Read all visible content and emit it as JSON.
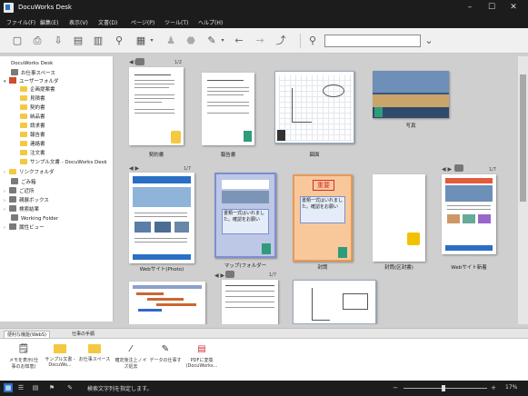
{
  "window": {
    "title": "DocuWorks Desk"
  },
  "menu": [
    "ファイル(F)",
    "編集(E)",
    "表示(V)",
    "文書(D)",
    "ページ(P)",
    "ツール(T)",
    "ヘルプ(H)"
  ],
  "tree": {
    "root": "DocuWorks Desk",
    "items": [
      "お仕事スペース",
      "ユーザーフォルダ",
      "企画提案書",
      "見積書",
      "契約書",
      "納品書",
      "請求書",
      "報告書",
      "連絡書",
      "注文書",
      "サンプル文書 - DocuWorks Desk",
      "リンクフォルダ",
      "ごみ箱",
      "ご近所",
      "親展ボックス",
      "検索結果",
      "Working Folder",
      "属性ビュー"
    ]
  },
  "documents": [
    {
      "caption": "契約書",
      "pages": "1/2"
    },
    {
      "caption": "報告書",
      "pages": ""
    },
    {
      "caption": "図面",
      "pages": ""
    },
    {
      "caption": "写真",
      "pages": ""
    },
    {
      "caption": "Webサイト(Photo)",
      "pages": "1/7"
    },
    {
      "caption": "マップ(フォルダー",
      "pages": ""
    },
    {
      "caption": "封筒",
      "pages": ""
    },
    {
      "caption": "封筒(区封書)",
      "pages": ""
    },
    {
      "caption": "Webサイト新着",
      "pages": "1/7"
    },
    {
      "caption": "",
      "pages": "1/7"
    },
    {
      "caption": "",
      "pages": ""
    },
    {
      "caption": "",
      "pages": ""
    }
  ],
  "stamp": {
    "label": "重要",
    "note1": "書類一式はいれました。確認をお願い",
    "note2": "書類一式はいれました。確認をお願い"
  },
  "tasktabs": [
    "便利な機能(WebS)",
    "仕事の手順"
  ],
  "tasks": [
    "メモを表示(仕事のお知恵)",
    "サンプル文書 - DocuWo...",
    "お仕事スペース",
    "確定後注上ノイズ処去",
    "データの仕事す",
    "PDFに変換(DocuWorks..."
  ],
  "statusbar": {
    "message": "検索文字列を指定します。",
    "zoom": "17%"
  },
  "colors": {
    "accent": "#2a6fc4",
    "chrome": "#1c1c1c",
    "folder": "#f5c842"
  }
}
